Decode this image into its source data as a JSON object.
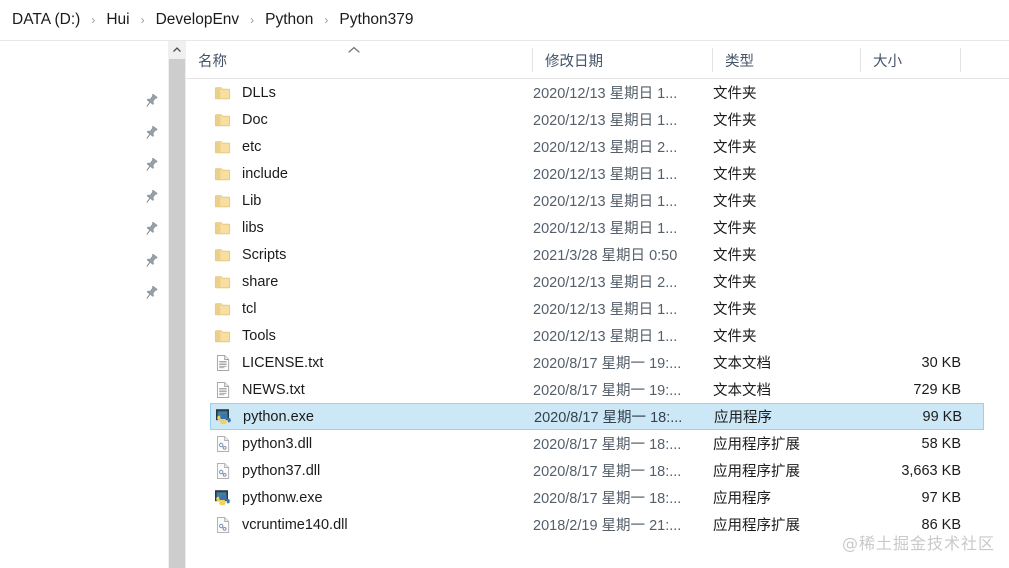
{
  "window": {
    "app": "file-explorer"
  },
  "breadcrumb": {
    "separator": "›",
    "items": [
      {
        "label": "DATA (D:)"
      },
      {
        "label": "Hui"
      },
      {
        "label": "DevelopEnv"
      },
      {
        "label": "Python"
      },
      {
        "label": "Python379"
      }
    ]
  },
  "sidebar": {
    "pins": [
      {
        "icon": "pin-icon"
      },
      {
        "icon": "pin-icon"
      },
      {
        "icon": "pin-icon"
      },
      {
        "icon": "pin-icon"
      },
      {
        "icon": "pin-icon"
      },
      {
        "icon": "pin-icon"
      },
      {
        "icon": "pin-icon"
      }
    ]
  },
  "scrollbar": {
    "up_icon": "chevron-up-icon",
    "thumb": "scrollbar-thumb"
  },
  "columns": {
    "name": "名称",
    "date": "修改日期",
    "type": "类型",
    "size": "大小",
    "sort_icon": "sort-ascending-icon"
  },
  "rows": [
    {
      "name": "DLLs",
      "icon": "folder-icon",
      "date": "2020/12/13 星期日 1...",
      "type": "文件夹",
      "size": ""
    },
    {
      "name": "Doc",
      "icon": "folder-icon",
      "date": "2020/12/13 星期日 1...",
      "type": "文件夹",
      "size": ""
    },
    {
      "name": "etc",
      "icon": "folder-icon",
      "date": "2020/12/13 星期日 2...",
      "type": "文件夹",
      "size": ""
    },
    {
      "name": "include",
      "icon": "folder-icon",
      "date": "2020/12/13 星期日 1...",
      "type": "文件夹",
      "size": ""
    },
    {
      "name": "Lib",
      "icon": "folder-icon",
      "date": "2020/12/13 星期日 1...",
      "type": "文件夹",
      "size": ""
    },
    {
      "name": "libs",
      "icon": "folder-icon",
      "date": "2020/12/13 星期日 1...",
      "type": "文件夹",
      "size": ""
    },
    {
      "name": "Scripts",
      "icon": "folder-icon",
      "date": "2021/3/28 星期日 0:50",
      "type": "文件夹",
      "size": ""
    },
    {
      "name": "share",
      "icon": "folder-icon",
      "date": "2020/12/13 星期日 2...",
      "type": "文件夹",
      "size": ""
    },
    {
      "name": "tcl",
      "icon": "folder-icon",
      "date": "2020/12/13 星期日 1...",
      "type": "文件夹",
      "size": ""
    },
    {
      "name": "Tools",
      "icon": "folder-icon",
      "date": "2020/12/13 星期日 1...",
      "type": "文件夹",
      "size": ""
    },
    {
      "name": "LICENSE.txt",
      "icon": "text-file-icon",
      "date": "2020/8/17 星期一 19:...",
      "type": "文本文档",
      "size": "30 KB"
    },
    {
      "name": "NEWS.txt",
      "icon": "text-file-icon",
      "date": "2020/8/17 星期一 19:...",
      "type": "文本文档",
      "size": "729 KB"
    },
    {
      "name": "python.exe",
      "icon": "python-exe-icon",
      "date": "2020/8/17 星期一 18:...",
      "type": "应用程序",
      "size": "99 KB",
      "selected": true
    },
    {
      "name": "python3.dll",
      "icon": "dll-file-icon",
      "date": "2020/8/17 星期一 18:...",
      "type": "应用程序扩展",
      "size": "58 KB"
    },
    {
      "name": "python37.dll",
      "icon": "dll-file-icon",
      "date": "2020/8/17 星期一 18:...",
      "type": "应用程序扩展",
      "size": "3,663 KB"
    },
    {
      "name": "pythonw.exe",
      "icon": "python-exe-icon",
      "date": "2020/8/17 星期一 18:...",
      "type": "应用程序",
      "size": "97 KB"
    },
    {
      "name": "vcruntime140.dll",
      "icon": "dll-file-icon",
      "date": "2018/2/19 星期一 21:...",
      "type": "应用程序扩展",
      "size": "86 KB"
    }
  ],
  "watermark": {
    "text": "@稀土掘金技术社区"
  },
  "colors": {
    "selection_fill": "#cce8f7",
    "selection_border": "#99d1f0",
    "folder": "#f2d98c",
    "header_text": "#44546a",
    "scrollbar_thumb": "#cdcdcd"
  }
}
